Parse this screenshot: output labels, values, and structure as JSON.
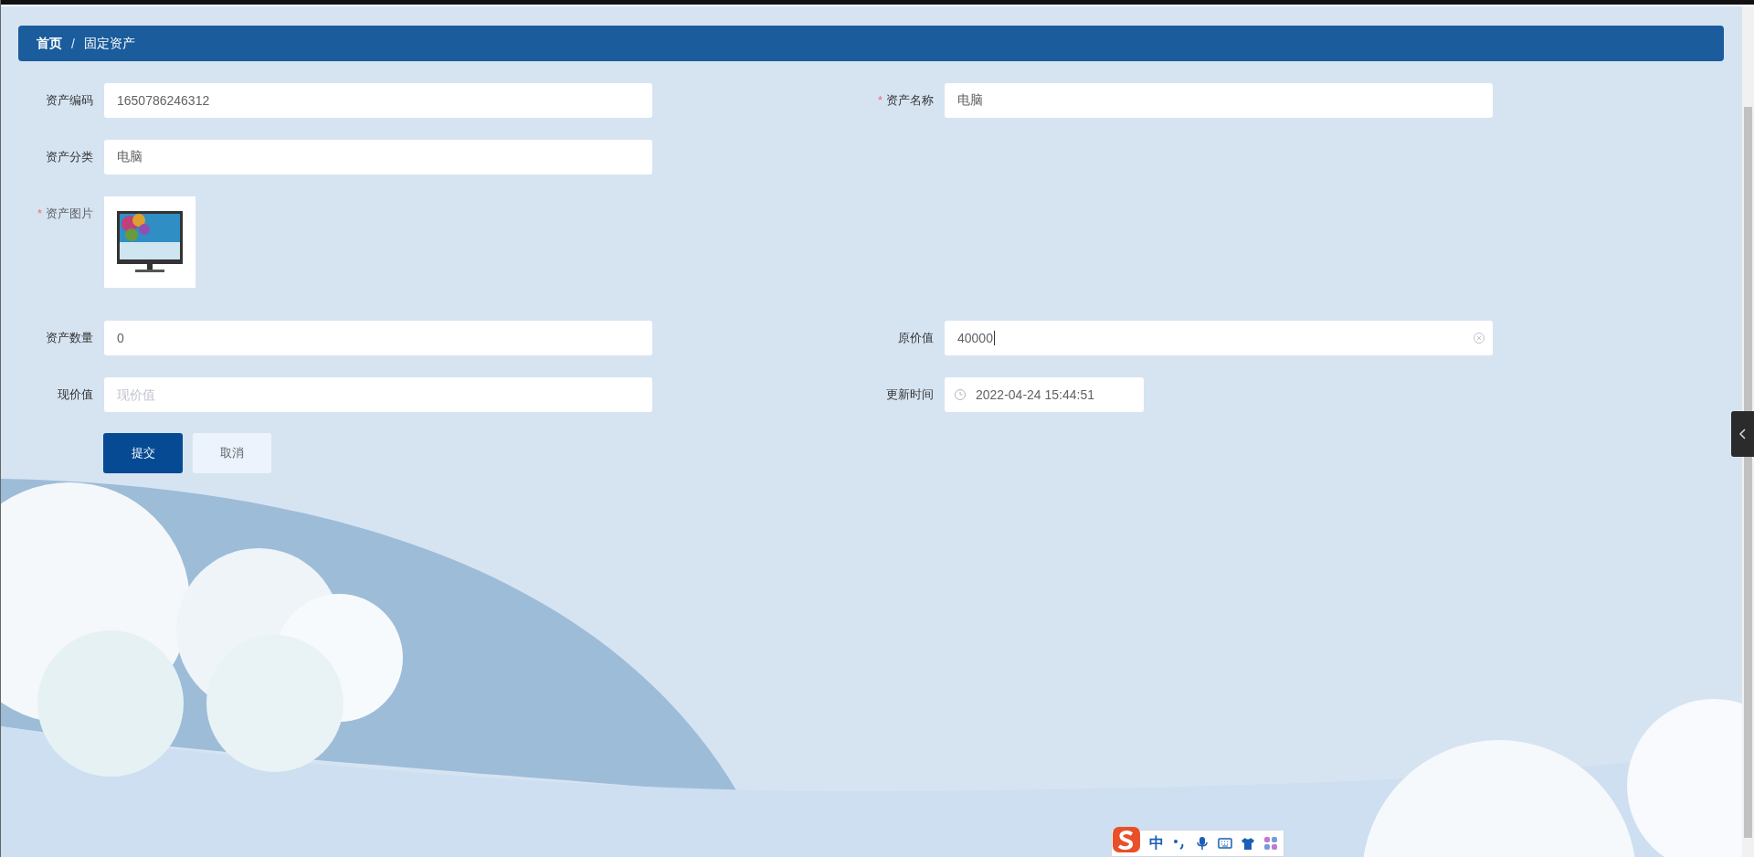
{
  "breadcrumb": {
    "separator": "/",
    "items": [
      {
        "label": "首页",
        "current": false
      },
      {
        "label": "固定资产",
        "current": true
      }
    ]
  },
  "form": {
    "rows": [
      {
        "fields": [
          {
            "kind": "text",
            "label": "资产编码",
            "value": "1650786246312"
          },
          {
            "kind": "text",
            "label": "资产名称",
            "required_mark": "*",
            "value": "电脑"
          }
        ]
      },
      {
        "fields": [
          {
            "kind": "text",
            "label": "资产分类",
            "value": "电脑"
          }
        ]
      },
      {
        "fields": [
          {
            "label": "资产图片",
            "required_mark": "*"
          }
        ]
      },
      {
        "fields": [
          {
            "kind": "text",
            "label": "资产数量",
            "value": "0"
          },
          {
            "kind": "text",
            "label": "原价值",
            "value": "40000",
            "focused": true,
            "clearable": true
          }
        ]
      },
      {
        "fields": [
          {
            "kind": "text",
            "label": "现价值",
            "placeholder": "现价值"
          },
          {
            "kind": "datetime",
            "label": "更新时间",
            "value": "2022-04-24 15:44:51"
          }
        ]
      }
    ],
    "buttons": [
      {
        "label": "提交",
        "kind": "primary"
      },
      {
        "label": "取消",
        "kind": "default"
      }
    ]
  },
  "ime_toolbar": {
    "mode": "中"
  }
}
